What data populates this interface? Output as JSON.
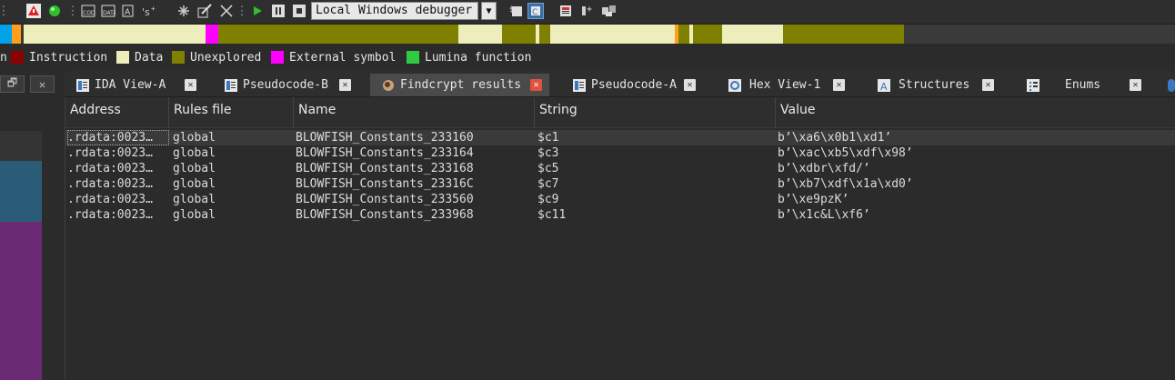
{
  "toolbar": {
    "debugger_label": "Local Windows debugger",
    "icons": [
      "warning-icon",
      "green-circle-icon",
      "code-icon",
      "data-icon",
      "string-icon",
      "sequence-icon",
      "snowflake-icon",
      "edit-icon",
      "cross-icon",
      "play-icon",
      "pause-icon",
      "stop-icon",
      "debugger-dropdown-icon",
      "attach-icon",
      "run-icon",
      "function-flag-icon",
      "add-bookmark-icon",
      "patch-icon"
    ]
  },
  "navband": {
    "colors": {
      "instruction": "#8b0000",
      "data": "#eeeebc",
      "unexplored": "#808000",
      "external": "#ff00ff",
      "lumina": "#2ecc40",
      "library": "#00a2e8",
      "orange": "#ff9f1c",
      "empty": "#3a3a3a"
    }
  },
  "legend": {
    "partial_prefix": "n",
    "items": [
      {
        "label": "Instruction",
        "color": "#8b0000"
      },
      {
        "label": "Data",
        "color": "#eeeebc"
      },
      {
        "label": "Unexplored",
        "color": "#808000"
      },
      {
        "label": "External symbol",
        "color": "#ff00ff"
      },
      {
        "label": "Lumina function",
        "color": "#2ecc40"
      }
    ]
  },
  "tabs": [
    {
      "label": "IDA View-A",
      "icon": "disassembly-icon",
      "active": false
    },
    {
      "label": "Pseudocode-B",
      "icon": "pseudocode-icon",
      "active": false
    },
    {
      "label": "Findcrypt results",
      "icon": "findcrypt-icon",
      "active": true
    },
    {
      "label": "Pseudocode-A",
      "icon": "pseudocode-icon",
      "active": false
    },
    {
      "label": "Hex View-1",
      "icon": "hex-icon",
      "active": false
    },
    {
      "label": "Structures",
      "icon": "structures-icon",
      "active": false
    },
    {
      "label": "Enums",
      "icon": "enums-icon",
      "active": false
    }
  ],
  "table": {
    "columns": [
      "Address",
      "Rules file",
      "Name",
      "String",
      "Value"
    ],
    "rows": [
      {
        "address": ".rdata:0023…",
        "rules": "global",
        "name": "BLOWFISH_Constants_233160",
        "string": "$c1",
        "value": "b’\\xa6\\x0b1\\xd1’"
      },
      {
        "address": ".rdata:0023…",
        "rules": "global",
        "name": "BLOWFISH_Constants_233164",
        "string": "$c3",
        "value": "b’\\xac\\xb5\\xdf\\x98’"
      },
      {
        "address": ".rdata:0023…",
        "rules": "global",
        "name": "BLOWFISH_Constants_233168",
        "string": "$c5",
        "value": "b’\\xdbr\\xfd/’"
      },
      {
        "address": ".rdata:0023…",
        "rules": "global",
        "name": "BLOWFISH_Constants_23316C",
        "string": "$c7",
        "value": "b’\\xb7\\xdf\\x1a\\xd0’"
      },
      {
        "address": ".rdata:0023…",
        "rules": "global",
        "name": "BLOWFISH_Constants_233560",
        "string": "$c9",
        "value": "b’\\xe9pzK’"
      },
      {
        "address": ".rdata:0023…",
        "rules": "global",
        "name": "BLOWFISH_Constants_233968",
        "string": "$c11",
        "value": "b’\\x1c&L\\xf6’"
      }
    ]
  }
}
